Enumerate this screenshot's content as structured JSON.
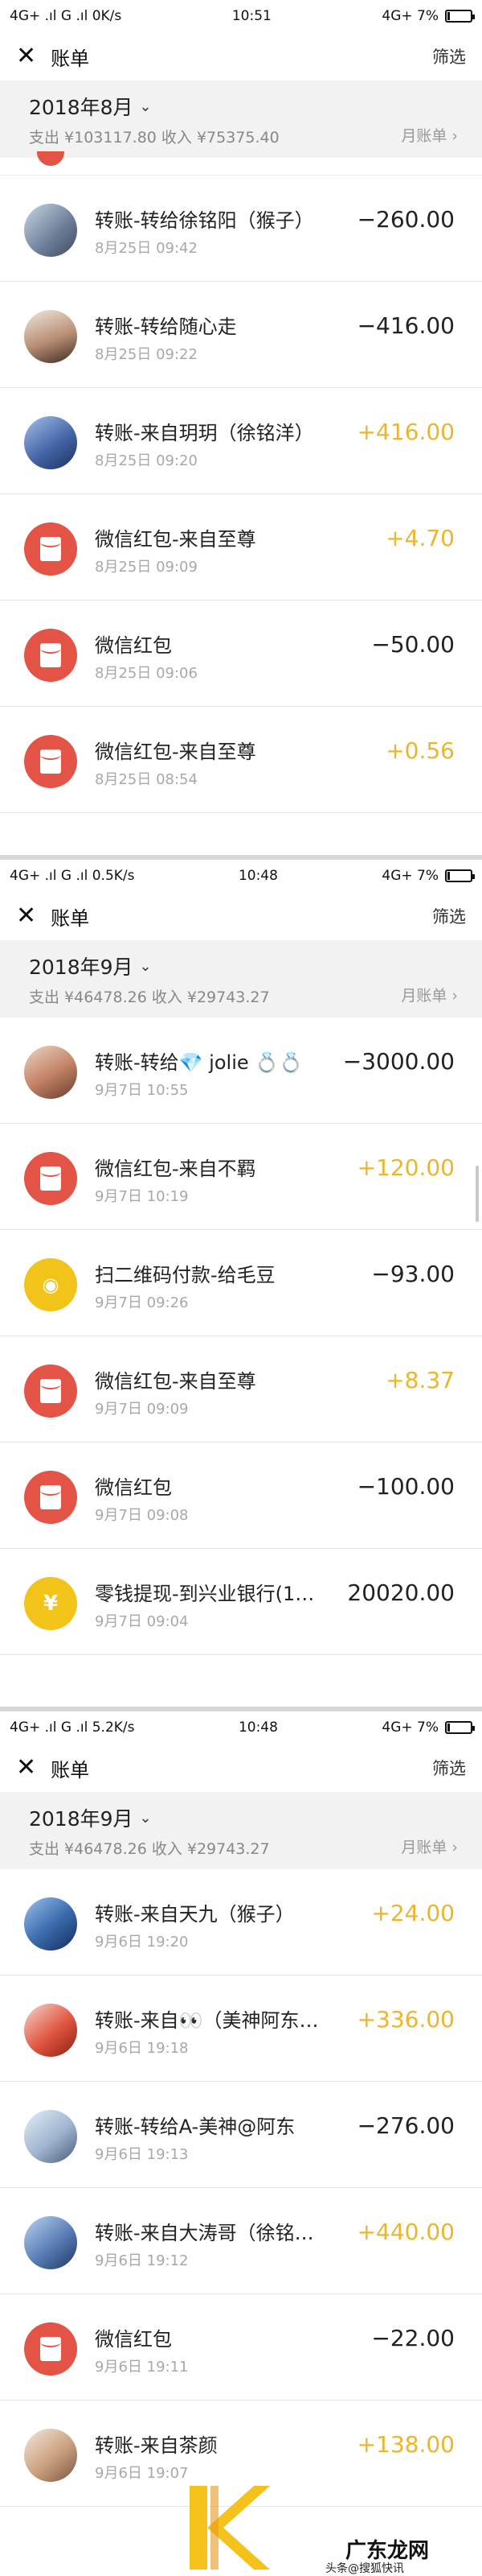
{
  "panels": [
    {
      "status": {
        "left": "4G+ .ıl G .ıl 0K/s",
        "time": "10:51",
        "right": "4G+ 7%"
      },
      "header": {
        "title": "账单",
        "filter": "筛选"
      },
      "month": {
        "label": "2018年8月",
        "summary": "支出 ¥103117.80 收入 ¥75375.40",
        "monthly": "月账单"
      },
      "items": [
        {
          "name": "转账-转给徐铭阳（猴子）",
          "time": "8月25日 09:42",
          "amount": "−260.00",
          "type": "out",
          "avatar": "photo"
        },
        {
          "name": "转账-转给随心走",
          "time": "8月25日 09:22",
          "amount": "−416.00",
          "type": "out",
          "avatar": "photo2"
        },
        {
          "name": "转账-来自玥玥（徐铭洋）",
          "time": "8月25日 09:20",
          "amount": "+416.00",
          "type": "in",
          "avatar": "photo3"
        },
        {
          "name": "微信红包-来自至尊",
          "time": "8月25日 09:09",
          "amount": "+4.70",
          "type": "in",
          "avatar": "redpacket"
        },
        {
          "name": "微信红包",
          "time": "8月25日 09:06",
          "amount": "−50.00",
          "type": "out",
          "avatar": "redpacket"
        },
        {
          "name": "微信红包-来自至尊",
          "time": "8月25日 08:54",
          "amount": "+0.56",
          "type": "in",
          "avatar": "redpacket"
        }
      ]
    },
    {
      "status": {
        "left": "4G+ .ıl G .ıl 0.5K/s",
        "time": "10:48",
        "right": "4G+ 7%"
      },
      "header": {
        "title": "账单",
        "filter": "筛选"
      },
      "month": {
        "label": "2018年9月",
        "summary": "支出 ¥46478.26 收入 ¥29743.27",
        "monthly": "月账单"
      },
      "items": [
        {
          "name": "转账-转给💎 jolie 💍💍",
          "time": "9月7日 10:55",
          "amount": "−3000.00",
          "type": "out",
          "avatar": "photo4"
        },
        {
          "name": "微信红包-来自不羁",
          "time": "9月7日 10:19",
          "amount": "+120.00",
          "type": "in",
          "avatar": "redpacket"
        },
        {
          "name": "扫二维码付款-给毛豆",
          "time": "9月7日 09:26",
          "amount": "−93.00",
          "type": "out",
          "avatar": "qr"
        },
        {
          "name": "微信红包-来自至尊",
          "time": "9月7日 09:09",
          "amount": "+8.37",
          "type": "in",
          "avatar": "redpacket"
        },
        {
          "name": "微信红包",
          "time": "9月7日 09:08",
          "amount": "−100.00",
          "type": "out",
          "avatar": "redpacket"
        },
        {
          "name": "零钱提现-到兴业银行(1…",
          "time": "9月7日 09:04",
          "amount": "20020.00",
          "type": "out",
          "avatar": "yuan"
        }
      ]
    },
    {
      "status": {
        "left": "4G+ .ıl G .ıl 5.2K/s",
        "time": "10:48",
        "right": "4G+ 7%"
      },
      "header": {
        "title": "账单",
        "filter": "筛选"
      },
      "month": {
        "label": "2018年9月",
        "summary": "支出 ¥46478.26 收入 ¥29743.27",
        "monthly": "月账单"
      },
      "items": [
        {
          "name": "转账-来自天九（猴子）",
          "time": "9月6日 19:20",
          "amount": "+24.00",
          "type": "in",
          "avatar": "photo5"
        },
        {
          "name": "转账-来自👀（美神阿东…",
          "time": "9月6日 19:18",
          "amount": "+336.00",
          "type": "in",
          "avatar": "photo6"
        },
        {
          "name": "转账-转给A-美神@阿东",
          "time": "9月6日 19:13",
          "amount": "−276.00",
          "type": "out",
          "avatar": "photo7"
        },
        {
          "name": "转账-来自大涛哥（徐铭…",
          "time": "9月6日 19:12",
          "amount": "+440.00",
          "type": "in",
          "avatar": "photo8"
        },
        {
          "name": "微信红包",
          "time": "9月6日 19:11",
          "amount": "−22.00",
          "type": "out",
          "avatar": "redpacket"
        },
        {
          "name": "转账-来自茶颜",
          "time": "9月6日 19:07",
          "amount": "+138.00",
          "type": "in",
          "avatar": "photo9"
        }
      ]
    }
  ],
  "watermark": {
    "text": "广东龙网",
    "sub": "头条@搜狐快讯"
  },
  "colors": {
    "income": "#ebb52f",
    "redpacket": "#e35346",
    "qr": "#f2c318"
  },
  "icons": {
    "close": "close-icon",
    "chevron": "chevron-down-icon",
    "arrow": "chevron-right-icon"
  }
}
